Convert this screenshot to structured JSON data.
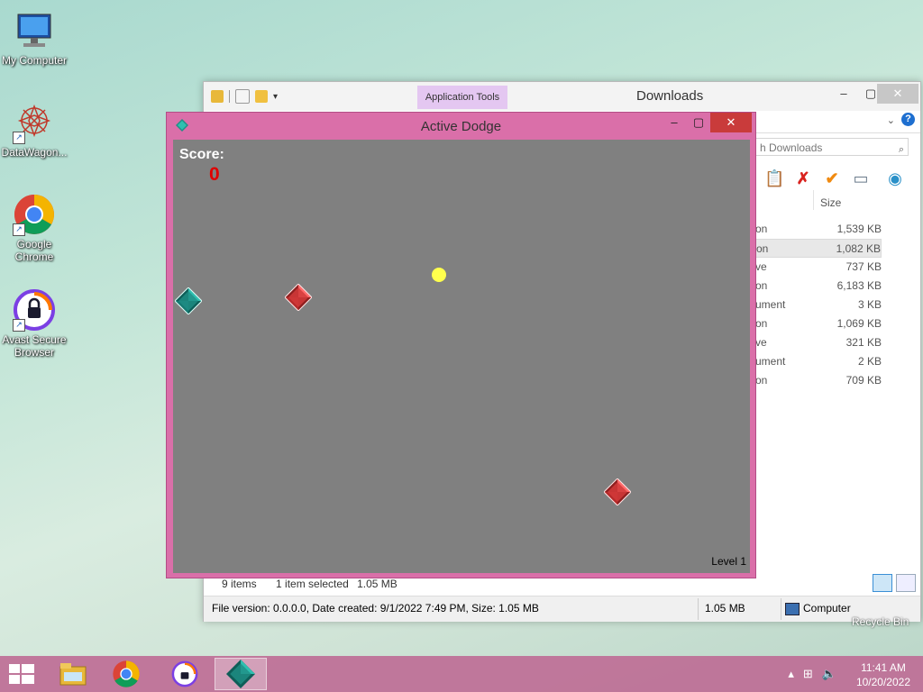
{
  "desktop": {
    "icons": [
      {
        "label": "My Computer",
        "icon": "computer-icon"
      },
      {
        "label": "DataWagon...",
        "icon": "datawagon-icon"
      },
      {
        "label": "Google Chrome",
        "icon": "chrome-icon"
      },
      {
        "label": "Avast Secure Browser",
        "icon": "avast-icon"
      }
    ],
    "recycle_label": "Recycle Bin"
  },
  "explorer": {
    "ribbon_tab": "Application Tools",
    "title": "Downloads",
    "search_placeholder": "h Downloads",
    "size_header": "Size",
    "rows": [
      {
        "type": "on",
        "size": "1,539 KB",
        "selected": false
      },
      {
        "type": "on",
        "size": "1,082 KB",
        "selected": true
      },
      {
        "type": "ve",
        "size": "737 KB",
        "selected": false
      },
      {
        "type": "on",
        "size": "6,183 KB",
        "selected": false
      },
      {
        "type": "ument",
        "size": "3 KB",
        "selected": false
      },
      {
        "type": "on",
        "size": "1,069 KB",
        "selected": false
      },
      {
        "type": "ve",
        "size": "321 KB",
        "selected": false
      },
      {
        "type": "ument",
        "size": "2 KB",
        "selected": false
      },
      {
        "type": "on",
        "size": "709 KB",
        "selected": false
      }
    ],
    "status": {
      "items": "9 items",
      "selected": "1 item selected",
      "selected_size": "1.05 MB"
    },
    "details": {
      "info": "File version: 0.0.0.0, Date created: 9/1/2022 7:49 PM, Size: 1.05 MB",
      "size": "1.05 MB",
      "location": "Computer"
    }
  },
  "game": {
    "title": "Active Dodge",
    "score_label": "Score:",
    "score": "0",
    "level": "Level 1"
  },
  "taskbar": {
    "time": "11:41 AM",
    "date": "10/20/2022"
  },
  "colors": {
    "game_frame": "#da6fa9",
    "game_bg": "#808080",
    "score": "#e00000",
    "ball": "#ffff4d",
    "red_gem": "#d23a3a",
    "teal_gem": "#1f8f86"
  }
}
